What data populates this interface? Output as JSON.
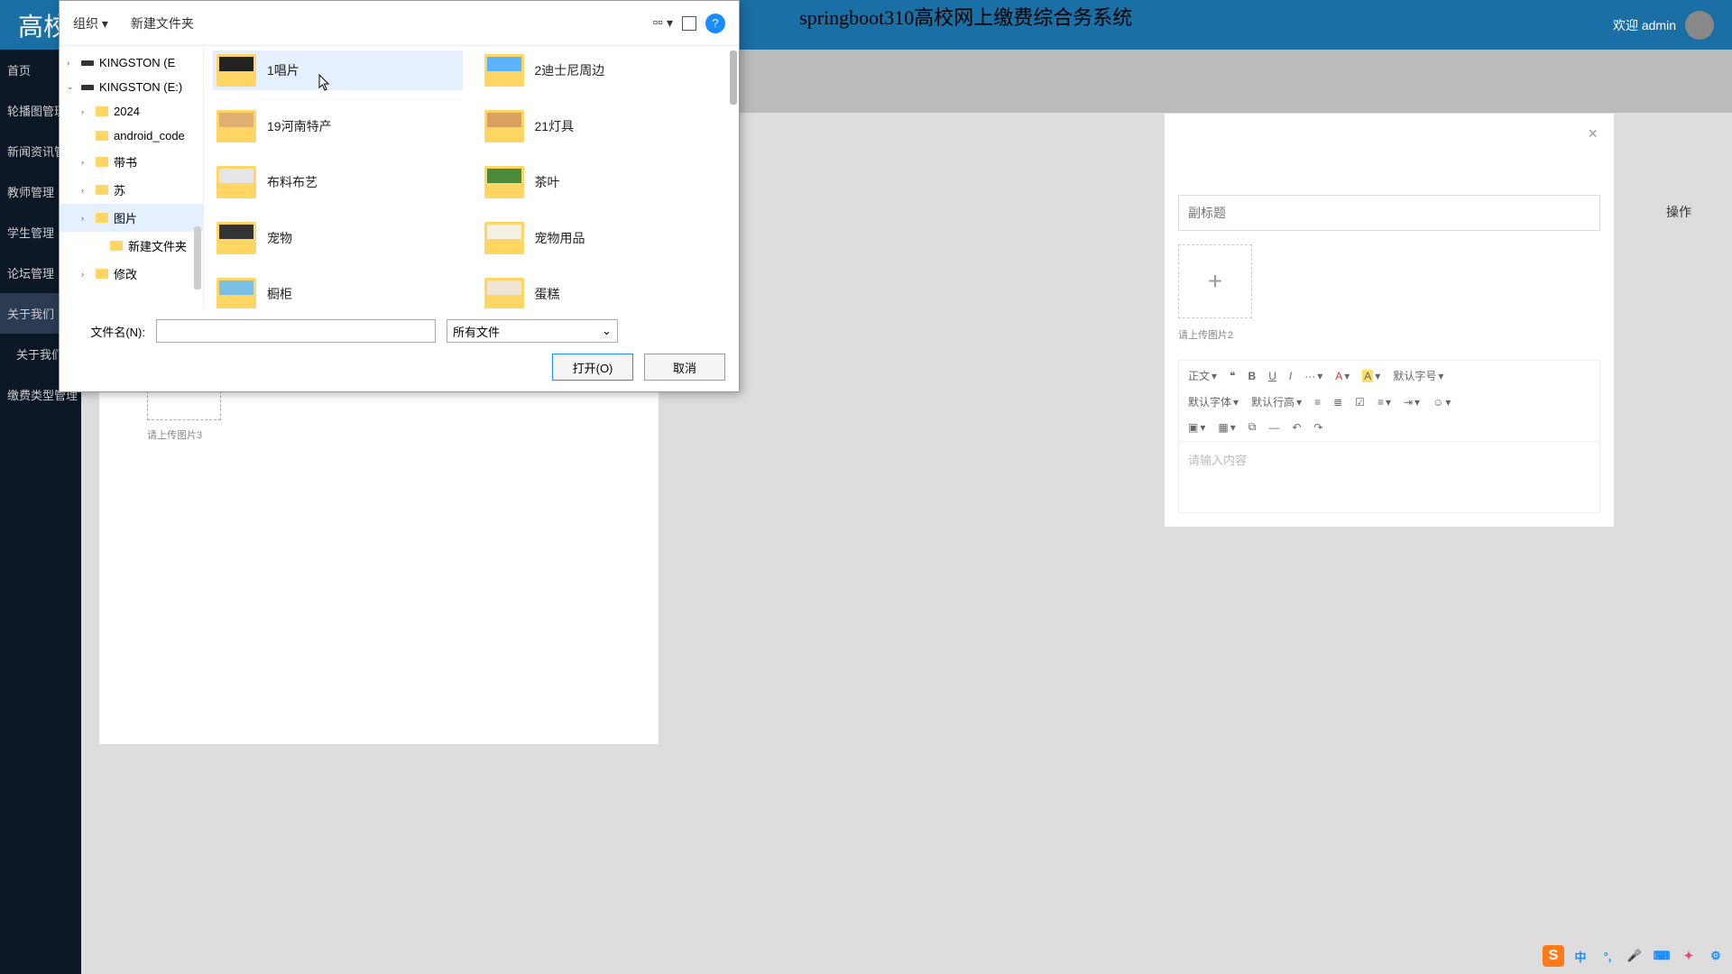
{
  "page_title": "springboot310高校网上缴费综合务系统",
  "header": {
    "brand": "高校网",
    "welcome": "欢迎 admin"
  },
  "sidebar": {
    "items": [
      {
        "label": "首页",
        "expandable": true
      },
      {
        "label": "轮播图管理",
        "expandable": false
      },
      {
        "label": "新闻资讯管理",
        "expandable": false
      },
      {
        "label": "教师管理",
        "expandable": true
      },
      {
        "label": "学生管理",
        "expandable": true
      },
      {
        "label": "论坛管理",
        "expandable": true
      },
      {
        "label": "关于我们",
        "expandable": true,
        "active": true
      },
      {
        "label": "关于我们",
        "expandable": false,
        "sub": true
      },
      {
        "label": "缴费类型管理",
        "expandable": true
      }
    ]
  },
  "table": {
    "op_header": "操作"
  },
  "modal_right": {
    "subtitle_placeholder": "副标题",
    "upload_hint": "请上传图片2",
    "editor_placeholder": "请输入内容",
    "toolbar": {
      "zhengwen": "正文",
      "quote": "❝",
      "bold": "B",
      "underline": "U",
      "italic": "I",
      "dots": "···",
      "fontcolor": "A",
      "bgcolor": "A",
      "hanzi": "默认字号",
      "fontfamily": "默认字体",
      "lineheight": "默认行高",
      "ul": "≡",
      "ol": "≣",
      "check": "☑",
      "align": "≡",
      "indent": "⇥",
      "emoji": "☺",
      "image": "▣",
      "table": "▦",
      "link": "⧉",
      "hr": "—",
      "undo": "↶",
      "redo": "↷"
    }
  },
  "left_modal": {
    "upload3_label": "请上传图片3"
  },
  "file_dialog": {
    "toolbar": {
      "organize": "组织",
      "new_folder": "新建文件夹"
    },
    "tree": [
      {
        "label": "KINGSTON (E",
        "type": "drive",
        "depth": 0,
        "arrow": "›"
      },
      {
        "label": "KINGSTON (E:)",
        "type": "drive",
        "depth": 0,
        "arrow": "⌄"
      },
      {
        "label": "2024",
        "type": "folder",
        "depth": 1,
        "arrow": "›"
      },
      {
        "label": "android_code",
        "type": "folder",
        "depth": 1,
        "arrow": ""
      },
      {
        "label": "带书",
        "type": "folder",
        "depth": 1,
        "arrow": "›"
      },
      {
        "label": "苏",
        "type": "folder",
        "depth": 1,
        "arrow": "›"
      },
      {
        "label": "图片",
        "type": "folder",
        "depth": 1,
        "arrow": "›",
        "selected": true
      },
      {
        "label": "新建文件夹",
        "type": "folder",
        "depth": 2,
        "arrow": ""
      },
      {
        "label": "修改",
        "type": "folder",
        "depth": 1,
        "arrow": "›"
      }
    ],
    "items": [
      {
        "label": "1唱片",
        "thumb": "#222",
        "hover": true
      },
      {
        "label": "2迪士尼周边",
        "thumb": "#5bb3ff"
      },
      {
        "label": "19河南特产",
        "thumb": "#e0b070"
      },
      {
        "label": "21灯具",
        "thumb": "#d9a060"
      },
      {
        "label": "布料布艺",
        "thumb": "#e5e5e5"
      },
      {
        "label": "茶叶",
        "thumb": "#4a8a3a"
      },
      {
        "label": "宠物",
        "thumb": "#333"
      },
      {
        "label": "宠物用品",
        "thumb": "#f5f0e5"
      },
      {
        "label": "橱柜",
        "thumb": "#7ac0e5"
      },
      {
        "label": "蛋糕",
        "thumb": "#f0e5d5"
      }
    ],
    "footer": {
      "filename_label": "文件名(N):",
      "filename_value": "",
      "filetype_label": "所有文件",
      "open_btn": "打开(O)",
      "cancel_btn": "取消"
    }
  },
  "ime": {
    "zhong": "中"
  }
}
